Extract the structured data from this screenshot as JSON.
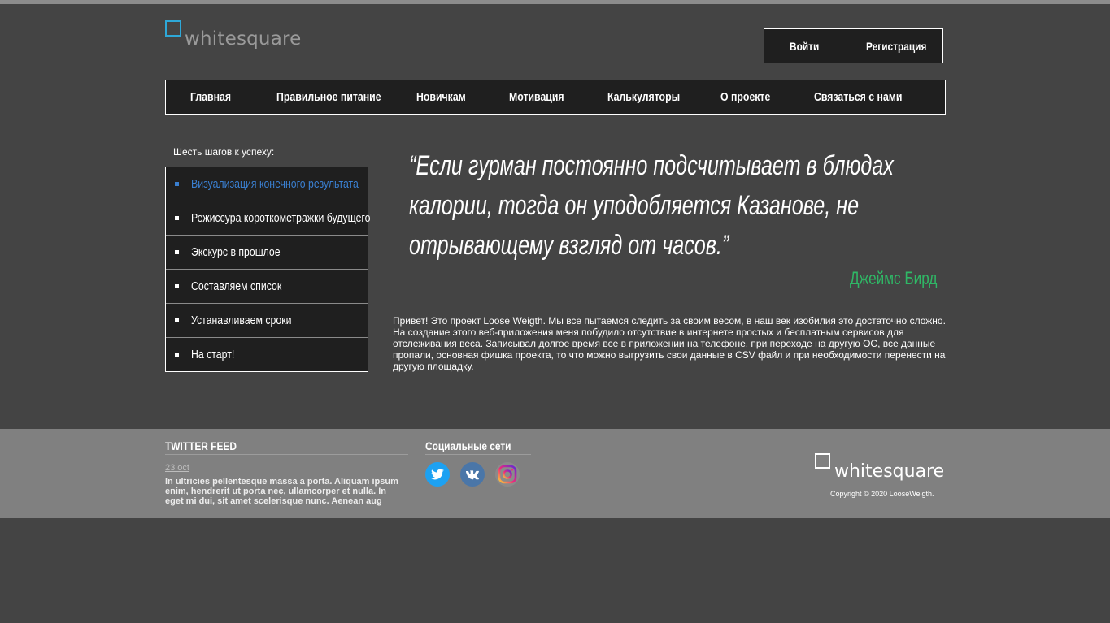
{
  "header": {
    "logo_text": "whitesquare",
    "login_label": "Войти",
    "register_label": "Регистрация"
  },
  "nav": {
    "items": [
      {
        "label": "Главная"
      },
      {
        "label": "Правильное питание"
      },
      {
        "label": "Новичкам"
      },
      {
        "label": "Мотивация"
      },
      {
        "label": "Калькуляторы"
      },
      {
        "label": "О проекте"
      },
      {
        "label": "Связаться с нами"
      }
    ]
  },
  "sidebar": {
    "title": "Шесть шагов к успеху:",
    "items": [
      {
        "label": "Визуализация конечного результата",
        "active": true
      },
      {
        "label": "Режиссура короткометражки будущего"
      },
      {
        "label": "Экскурс в прошлое"
      },
      {
        "label": "Составляем список"
      },
      {
        "label": "Устанавливаем сроки"
      },
      {
        "label": "На старт!"
      }
    ]
  },
  "quote": {
    "lines": [
      "“Если гурман постоянно подсчитывает в блюдах",
      "калории, тогда он уподобляется Казанове, не",
      "отрывающему взгляд от часов.”"
    ],
    "author": "Джеймс Бирд"
  },
  "about": {
    "text": "Привет! Это проект Loose Weigth. Мы все пытаемся следить за своим весом, в наш век изобилия это достаточно сложно. На создание этого веб-приложения меня побудило отсутствие в интернете простых и бесплатным сервисов для отслеживания веса. Записывал долгое время все в приложении на телефоне, при переходе на другую ОС, все данные пропали, основная фишка проекта, то что можно выгрузить свои данные в CSV файл и при необходимости перенести на другую площадку."
  },
  "footer": {
    "twitter_title": "TWITTER FEED",
    "tweet_date": "23 oct",
    "tweet_text": "In ultricies pellentesque massa a porta. Aliquam ipsum enim, hendrerit ut porta nec, ullamcorper et nulla. In eget mi dui, sit amet scelerisque nunc. Aenean aug",
    "social_title": "Социальные сети",
    "social_icons": [
      "twitter-icon",
      "vk-icon",
      "instagram-icon"
    ],
    "logo_text": "whitesquare",
    "copyright": "Copyright © 2020 LooseWeigth."
  },
  "colors": {
    "background": "#444444",
    "panel": "#1f1f1f",
    "footer": "#808080",
    "accent_blue": "#3a7fd0",
    "logo_square": "#2ea8d8",
    "author_green": "#2fb866"
  }
}
